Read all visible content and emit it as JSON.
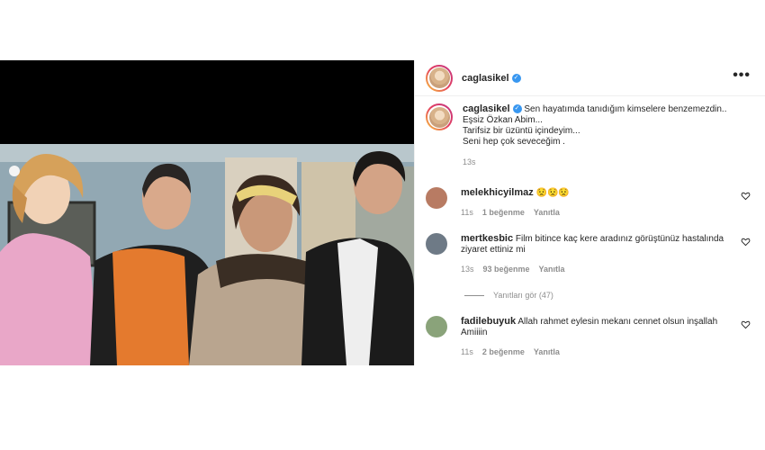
{
  "post": {
    "username": "caglasikel",
    "more_icon": "more-horizontal-icon",
    "caption_lines": [
      "Sen hayatımda tanıdığım kimselere benzemezdin..",
      "Eşsiz Özkan Abim...",
      "Tarifsiz bir üzüntü içindeyim...",
      "Seni hep çok seveceğim ."
    ],
    "caption_time": "13s"
  },
  "comments": [
    {
      "username": "melekhicyilmaz",
      "text": "😟😟😟",
      "time": "11s",
      "likes": "1 beğenme",
      "reply": "Yanıtla",
      "avatar_color": "#b87b63"
    },
    {
      "username": "mertkesbic",
      "text": "Film bitince kaç kere aradınız görüştünüz hastalında ziyaret ettiniz mi",
      "time": "13s",
      "likes": "93 beğenme",
      "reply": "Yanıtla",
      "avatar_color": "#6e7a86"
    },
    {
      "username": "fadilebuyuk",
      "text": "Allah rahmet eylesin mekanı cennet olsun inşallah Amiiiin",
      "time": "11s",
      "likes": "2 beğenme",
      "reply": "Yanıtla",
      "avatar_color": "#8aa37a"
    }
  ],
  "view_replies": "Yanıtları gör (47)",
  "colors": {
    "verified": "#3897f0",
    "secondary_text": "#8e8e8e",
    "primary_text": "#262626"
  }
}
